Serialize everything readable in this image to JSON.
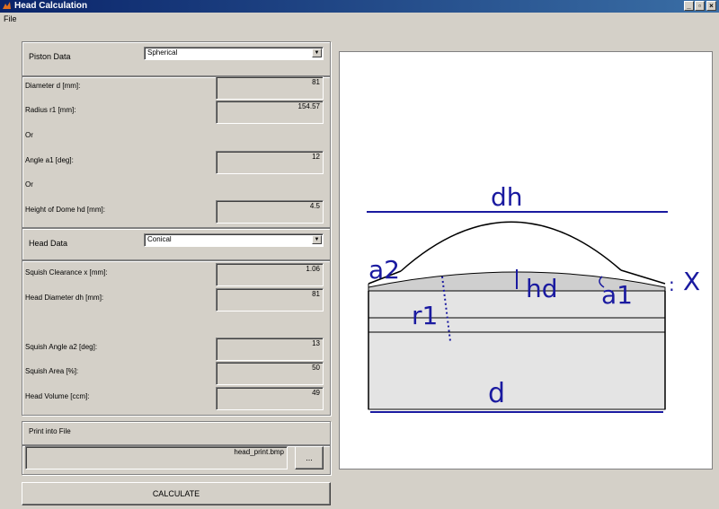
{
  "window": {
    "title": "Head Calculation"
  },
  "menu": {
    "file": "File"
  },
  "piston": {
    "header": "Piston Data",
    "type": "Spherical",
    "diameter_label": "Diameter d [mm]:",
    "diameter_value": "81",
    "radius_label": "Radius r1 [mm]:",
    "radius_value": "154.57",
    "or1": "Or",
    "angle_label": "Angle a1 [deg]:",
    "angle_value": "12",
    "or2": "Or",
    "dome_label": "Height of Dome hd [mm]:",
    "dome_value": "4.5"
  },
  "head": {
    "header": "Head Data",
    "type": "Conical",
    "squish_clearance_label": "Squish Clearance x [mm]:",
    "squish_clearance_value": "1.06",
    "head_diameter_label": "Head Diameter dh [mm]:",
    "head_diameter_value": "81",
    "squish_angle_label": "Squish Angle a2 [deg]:",
    "squish_angle_value": "13",
    "squish_area_label": "Squish Area [%]:",
    "squish_area_value": "50",
    "head_volume_label": "Head Volume [ccm]:",
    "head_volume_value": "49"
  },
  "print": {
    "header": "Print into File",
    "filename": "head_print.bmp",
    "browse_label": "..."
  },
  "calculate_label": "CALCULATE",
  "diagram": {
    "dh": "dh",
    "a2": "a2",
    "hd": "hd",
    "a1": "a1",
    "x": "X",
    "r1": "r1",
    "d": "d"
  }
}
